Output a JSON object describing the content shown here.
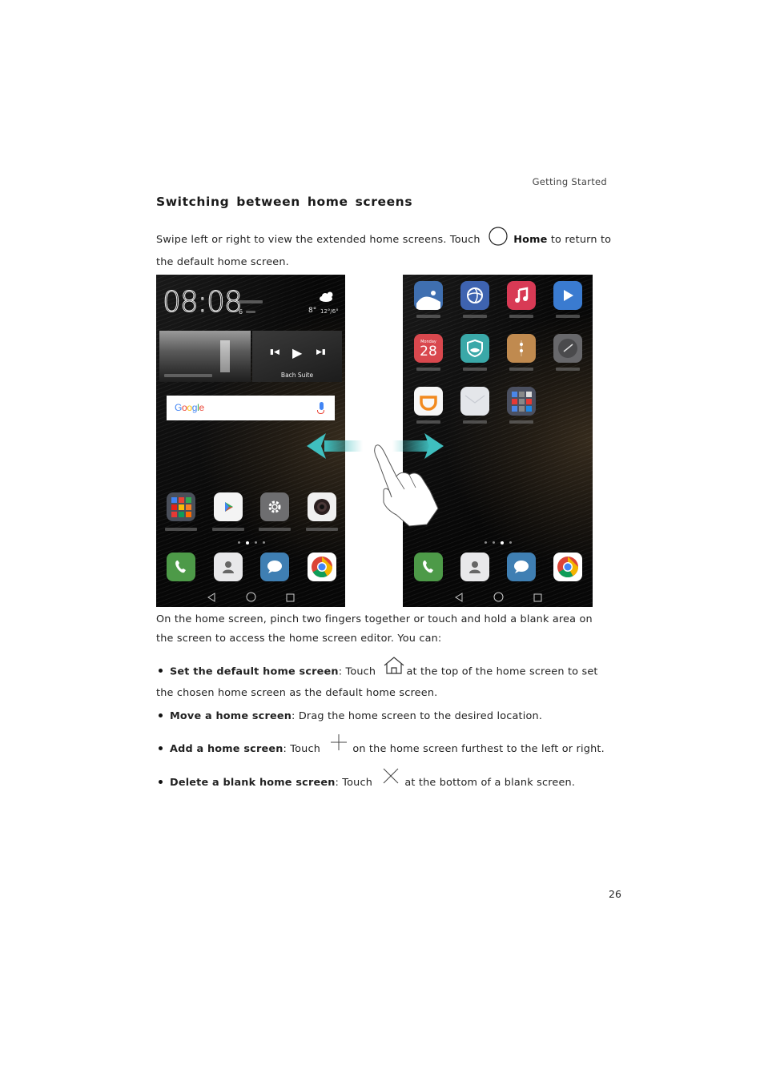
{
  "header": {
    "running_head": "Getting Started"
  },
  "section": {
    "title": "Switching between home screens",
    "intro_part1": "Swipe left or right to view the extended home screens. Touch",
    "intro_icon": "circle-home-icon",
    "intro_bold": "Home",
    "intro_part2": "to return to the default home screen."
  },
  "figure": {
    "left_screen": {
      "clock": "08:08",
      "date_prefix": "6",
      "weather_temp": "8°",
      "weather_range": "12°/6°",
      "music_title": "Bach Suite",
      "search_brand": "Google",
      "apps_row": [
        {
          "icon": "google-folder-icon",
          "color": "#4a4f5a"
        },
        {
          "icon": "play-store-icon",
          "color": "#f4f4f4"
        },
        {
          "icon": "settings-icon",
          "color": "#6e6e70"
        },
        {
          "icon": "camera-icon",
          "color": "#f0f0f0"
        }
      ],
      "page_indicator": {
        "count": 4,
        "active": 2
      },
      "dock": [
        {
          "icon": "phone-icon",
          "color": "#4d9a48"
        },
        {
          "icon": "contacts-icon",
          "color": "#e8e8ea"
        },
        {
          "icon": "messages-icon",
          "color": "#3f7fb3"
        },
        {
          "icon": "chrome-icon",
          "color": "#ffffff"
        }
      ]
    },
    "right_screen": {
      "calendar_day": "Monday",
      "calendar_date": "28",
      "apps_grid": [
        {
          "icon": "gallery-icon",
          "color": "#3f6fb0"
        },
        {
          "icon": "themes-icon",
          "color": "#3e63b0"
        },
        {
          "icon": "music-icon",
          "color": "#d83a55"
        },
        {
          "icon": "videos-icon",
          "color": "#3a7bd0"
        },
        {
          "icon": "calendar-icon",
          "color": "#d9484e"
        },
        {
          "icon": "phone-manager-icon",
          "color": "#3aa8a8"
        },
        {
          "icon": "files-icon",
          "color": "#c08a4f"
        },
        {
          "icon": "clock-icon",
          "color": "#68686b"
        },
        {
          "icon": "didi-icon",
          "color": "#f7f7f7"
        },
        {
          "icon": "email-icon",
          "color": "#e4e6ea"
        },
        {
          "icon": "tools-folder-icon",
          "color": "#4b5060"
        }
      ],
      "page_indicator": {
        "count": 4,
        "active": 3
      },
      "dock": [
        {
          "icon": "phone-icon",
          "color": "#4d9a48"
        },
        {
          "icon": "contacts-icon",
          "color": "#e8e8ea"
        },
        {
          "icon": "messages-icon",
          "color": "#3f7fb3"
        },
        {
          "icon": "chrome-icon",
          "color": "#ffffff"
        }
      ]
    },
    "arrow_color": "#3fbfbf"
  },
  "body": {
    "editor_intro": "On the home screen, pinch two fingers together or touch and hold a blank area on the screen to access the home screen editor. You can:",
    "bullets": [
      {
        "bold": "Set the default home screen",
        "pre": ": Touch",
        "icon": "home-icon",
        "post": "at the top of the home screen to set the chosen home screen as the default home screen."
      },
      {
        "bold": "Move a home screen",
        "pre": ": Drag the home screen to the desired location.",
        "icon": "",
        "post": ""
      },
      {
        "bold": "Add a home screen",
        "pre": ": Touch",
        "icon": "plus-icon",
        "post": "on the home screen furthest to the left or right."
      },
      {
        "bold": "Delete a blank home screen",
        "pre": ": Touch",
        "icon": "close-icon",
        "post": "at the bottom of a blank screen."
      }
    ]
  },
  "footer": {
    "page_number": "26"
  }
}
